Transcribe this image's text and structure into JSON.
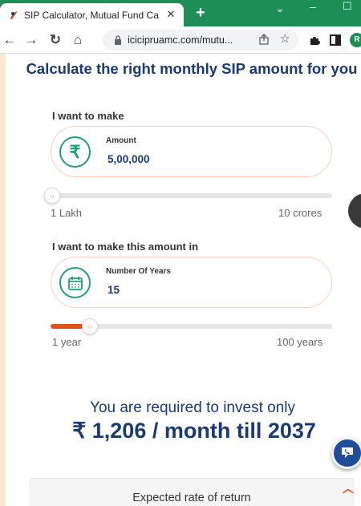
{
  "browser": {
    "tab_title": "SIP Calculator, Mutual Fund Calcu",
    "tab_close": "✕",
    "new_tab": "+",
    "url": "icicipruamc.com/mutu...",
    "profile_initial": "R",
    "theme_color": "#1e8e57"
  },
  "page": {
    "heading": "Calculate the right monthly SIP amount for you",
    "amount_section": {
      "label": "I want to make",
      "field_label": "Amount",
      "field_value": "5,00,000",
      "icon": "rupee-icon",
      "slider_min_label": "1 Lakh",
      "slider_max_label": "10 crores",
      "slider_value_fraction": 0.0
    },
    "years_section": {
      "label": "I want to make this amount in",
      "field_label": "Number Of Years",
      "field_value": "15",
      "icon": "calendar-icon",
      "slider_min_label": "1 year",
      "slider_max_label": "100 years",
      "slider_value_fraction": 0.14
    },
    "result": {
      "line1": "You are required to invest only",
      "line2": "₹ 1,206 / month till 2037"
    },
    "rate_card": {
      "title": "Expected rate of return"
    },
    "colors": {
      "brand_navy": "#1b3a73",
      "accent_orange": "#e0511c",
      "icon_green": "#20a077"
    }
  }
}
